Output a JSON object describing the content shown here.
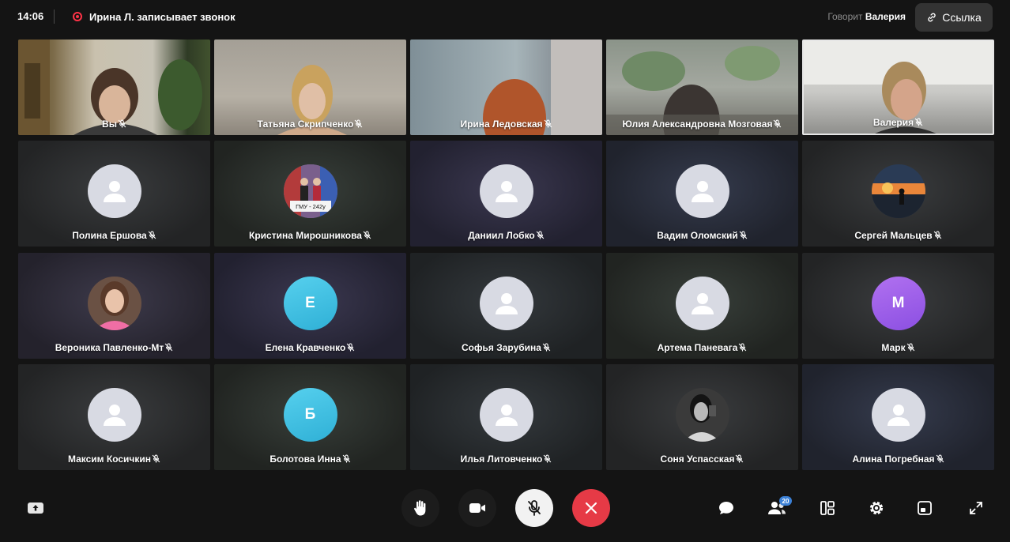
{
  "header": {
    "time": "14:06",
    "recording_text": "Ирина Л. записывает звонок",
    "speaking_label": "Говорит",
    "speaking_name": "Валерия",
    "link_label": "Ссылка"
  },
  "participants": [
    {
      "name": "Вы",
      "type": "video"
    },
    {
      "name": "Татьяна Скрипченко",
      "type": "video"
    },
    {
      "name": "Ирина Ледовская",
      "type": "video"
    },
    {
      "name": "Юлия Александровна Мозговая",
      "type": "video"
    },
    {
      "name": "Валерия",
      "type": "video",
      "speaking": true
    },
    {
      "name": "Полина Ершова",
      "type": "generic"
    },
    {
      "name": "Кристина Мирошникова",
      "type": "photo",
      "photo_caption": "ГМУ - 242у"
    },
    {
      "name": "Даниил Лобко",
      "type": "generic"
    },
    {
      "name": "Вадим Оломский",
      "type": "generic"
    },
    {
      "name": "Сергей Мальцев",
      "type": "photo"
    },
    {
      "name": "Вероника Павленко-Мт",
      "type": "photo"
    },
    {
      "name": "Елена Кравченко",
      "type": "letter",
      "letter": "Е",
      "color": "#3fbfe2"
    },
    {
      "name": "Софья Зарубина",
      "type": "generic"
    },
    {
      "name": "Артема Паневага",
      "type": "generic"
    },
    {
      "name": "Марк",
      "type": "letter",
      "letter": "М",
      "color": "#9b5de8"
    },
    {
      "name": "Максим Косичкин",
      "type": "generic"
    },
    {
      "name": "Болотова Инна",
      "type": "letter",
      "letter": "Б",
      "color": "#3fbfe2"
    },
    {
      "name": "Илья Литовченко",
      "type": "generic"
    },
    {
      "name": "Соня Успасская",
      "type": "photo"
    },
    {
      "name": "Алина Погребная",
      "type": "generic"
    }
  ],
  "toolbar": {
    "participants_count": "20",
    "end_call_color": "#e63a46",
    "icons": [
      "screen-share-icon",
      "raise-hand-icon",
      "camera-icon",
      "mic-off-icon",
      "end-call-icon",
      "chat-icon",
      "participants-icon",
      "layout-icon",
      "settings-icon",
      "picture-in-picture-icon",
      "fullscreen-icon"
    ]
  }
}
